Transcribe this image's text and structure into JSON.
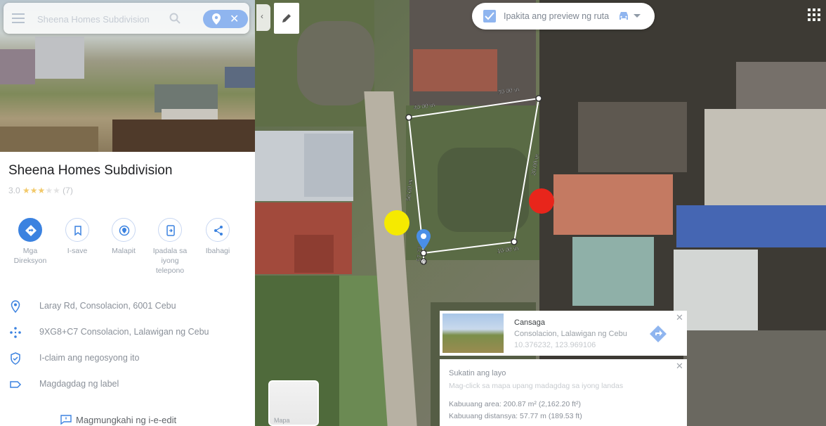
{
  "search": {
    "query": "Sheena Homes Subdivision"
  },
  "place": {
    "title": "Sheena Homes Subdivision",
    "rating_value": "3.0",
    "stars": "★★★",
    "empty_stars": "★★",
    "review_count": "(7)"
  },
  "actions": [
    {
      "label": "Mga Direksyon",
      "icon": "directions-icon"
    },
    {
      "label": "I-save",
      "icon": "bookmark-icon"
    },
    {
      "label": "Malapit",
      "icon": "nearby-icon"
    },
    {
      "label": "Ipadala sa iyong telepono",
      "icon": "send-to-phone-icon"
    },
    {
      "label": "Ibahagi",
      "icon": "share-icon"
    }
  ],
  "info_rows": [
    {
      "text": "Laray Rd, Consolacion, 6001 Cebu",
      "icon": "location-pin-icon"
    },
    {
      "text": "9XG8+C7 Consolacion, Lalawigan ng Cebu",
      "icon": "plus-code-icon"
    },
    {
      "text": "I-claim ang negosyong ito",
      "icon": "verified-shield-icon"
    },
    {
      "text": "Magdagdag ng label",
      "icon": "label-icon"
    }
  ],
  "suggest_edit": "Magmungkahi ng i-e-edit",
  "preview_toggle": {
    "label": "Ipakita ang preview ng ruta",
    "checked": true
  },
  "measurements": {
    "segment_1": "40.00 m",
    "segment_2": "30.00 m",
    "segment_3": "20.00 m",
    "segment_4": "10.00 m",
    "segment_5": "50.00 m",
    "segment_6": "57.77 m",
    "start_marker": "0"
  },
  "place_card": {
    "name": "Cansaga",
    "address": "Consolacion, Lalawigan ng Cebu",
    "coords": "10.376232, 123.969106"
  },
  "measure_card": {
    "heading": "Sukatin ang layo",
    "hint": "Mag-click sa mapa upang madagdag sa iyong landas",
    "area": "Kabuuang area: 200.87 m² (2,162.20 ft²)",
    "distance": "Kabuuang distansya: 57.77 m (189.53 ft)"
  },
  "layers": {
    "label": "Mapa"
  },
  "colors": {
    "accent_blue": "#3b82e0",
    "marker_red": "#e8251b",
    "marker_yellow": "#f5ea00"
  }
}
